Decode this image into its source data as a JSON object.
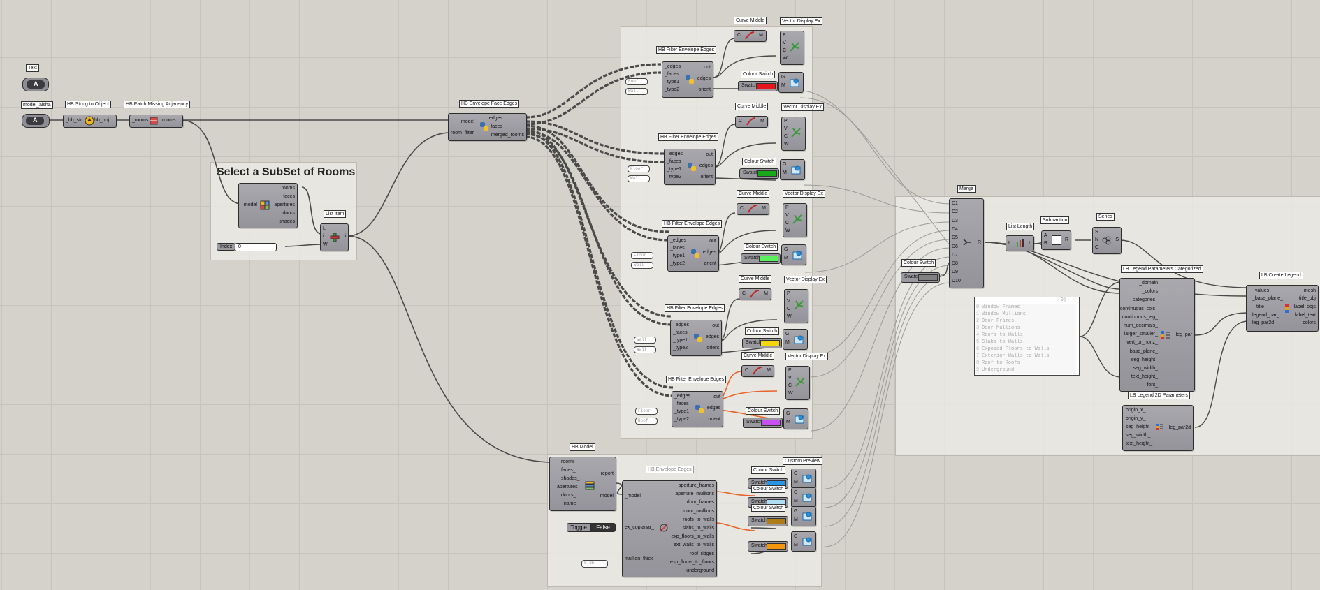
{
  "canvas": {
    "background": "#d5d2cb",
    "grid_color": "#c7c4bd"
  },
  "groups": {
    "select_subset": {
      "title": "Select a SubSet of Rooms"
    }
  },
  "text_param": {
    "tag": "Text",
    "glyph": "A"
  },
  "model_param": {
    "tag": "model_aisha",
    "glyph": "A"
  },
  "string_to_object": {
    "title": "HB String to Object",
    "input": "_hb_str",
    "output": "hb_obj"
  },
  "patch_adjacency": {
    "title": "HB Patch Missing Adjacency",
    "input": "_rooms",
    "output": "rooms"
  },
  "deconstruct": {
    "inputs": [
      "_model"
    ],
    "outputs": [
      "rooms",
      "faces",
      "apertures",
      "doors",
      "shades"
    ]
  },
  "list_item": {
    "title": "List Item",
    "inputs": [
      "L",
      "i",
      "W"
    ],
    "output": "i"
  },
  "index_slider": {
    "label": "Index",
    "value": "0"
  },
  "envelope_face_edges": {
    "title": "HB Envelope Face Edges",
    "inputs": [
      "_model",
      "room_filter_"
    ],
    "outputs": [
      "edges",
      "faces",
      "merged_rooms"
    ]
  },
  "filters": [
    {
      "title": "HB Filter Envelope Edges",
      "inputs": [
        "_edges",
        "_faces",
        "_type1",
        "_type2"
      ],
      "outputs": [
        "out",
        "edges",
        "orient"
      ],
      "panels": [
        "Roof",
        "Wall"
      ],
      "curve_middle": "Curve Middle",
      "vector_display": "Vector Display Ex",
      "colour_switch": "Colour Switch",
      "swatch": "Swatch",
      "color": "#e8141c"
    },
    {
      "title": "HB Filter Envelope Edges",
      "inputs": [
        "_edges",
        "_faces",
        "_type1",
        "_type2"
      ],
      "outputs": [
        "out",
        "edges",
        "orient"
      ],
      "panels": [
        "Floor",
        "Wall"
      ],
      "curve_middle": "Curve Middle",
      "vector_display": "Vector Display Ex",
      "colour_switch": "Colour Switch",
      "swatch": "Swatch",
      "color": "#18a818"
    },
    {
      "title": "HB Filter Envelope Edges",
      "inputs": [
        "_edges",
        "_faces",
        "_type1",
        "_type2"
      ],
      "outputs": [
        "out",
        "edges",
        "orient"
      ],
      "panels": [
        "Floor",
        "Wall"
      ],
      "curve_middle": "Curve Middle",
      "vector_display": "Vector Display Ex",
      "colour_switch": "Colour Switch",
      "swatch": "Swatch",
      "color": "#5cf05c"
    },
    {
      "title": "HB Filter Envelope Edges",
      "inputs": [
        "_edges",
        "_faces",
        "_type1",
        "_type2"
      ],
      "outputs": [
        "out",
        "edges",
        "orient"
      ],
      "panels": [
        "Wall",
        "Wall"
      ],
      "curve_middle": "Curve Middle",
      "vector_display": "Vector Display Ex",
      "colour_switch": "Colour Switch",
      "swatch": "Swatch",
      "color": "#f4d60c"
    },
    {
      "title": "HB Filter Envelope Edges",
      "inputs": [
        "_edges",
        "_faces",
        "_type1",
        "_type2"
      ],
      "outputs": [
        "out",
        "edges",
        "orient"
      ],
      "panels": [
        "Floor",
        "Roof"
      ],
      "curve_middle": "Curve Middle",
      "vector_display": "Vector Display Ex",
      "colour_switch": "Colour Switch",
      "swatch": "Swatch",
      "color": "#c850f0"
    }
  ],
  "curve_middle_pins": {
    "input": "C",
    "output": "M"
  },
  "vector_display_pins": [
    "P",
    "V",
    "C",
    "W"
  ],
  "custom_preview_pins": [
    "G",
    "M"
  ],
  "preview_tag": "Custom Preview",
  "hb_model": {
    "title": "HB Model",
    "inputs": [
      "rooms_",
      "faces_",
      "shades_",
      "apertures_",
      "doors_",
      "_name_"
    ],
    "outputs": [
      "report",
      "model"
    ]
  },
  "hb_envelope_edges": {
    "title": "HB Envelope Edges",
    "inputs": [
      "_model",
      "ex_coplanar_",
      "mullion_thick_"
    ],
    "outputs": [
      "aperture_frames",
      "aperture_mullions",
      "door_frames",
      "door_mullions",
      "roofs_to_walls",
      "slabs_to_walls",
      "exp_floors_to_walls",
      "ext_walls_to_walls",
      "roof_ridges",
      "exp_floors_to_floors",
      "underground"
    ]
  },
  "toggle": {
    "label": "Toggle",
    "value": "False"
  },
  "mullion_panel": "0.25",
  "bottom_swatches": [
    {
      "tag": "Colour Switch",
      "label": "Swatch",
      "color": "#2896e6"
    },
    {
      "tag": "Colour Switch",
      "label": "Swatch",
      "color": "#b0dcf4"
    },
    {
      "tag": "Colour Switch",
      "label": "Swatch",
      "color": "#b07c18"
    },
    {
      "tag": "",
      "label": "Swatch",
      "color": "#f4960c"
    }
  ],
  "merge": {
    "title": "Merge",
    "inputs": [
      "D1",
      "D2",
      "D3",
      "D4",
      "D5",
      "D6",
      "D7",
      "D8",
      "D9",
      "D10"
    ],
    "output": "R"
  },
  "grey_swatch": {
    "tag": "Colour Switch",
    "label": "Swatch",
    "color": "#808080"
  },
  "list_length": {
    "title": "List Length",
    "input": "L",
    "output": "L"
  },
  "subtraction": {
    "title": "Subtraction",
    "inputs": [
      "A",
      "B"
    ],
    "output": "R",
    "symbol": "−"
  },
  "series": {
    "title": "Series",
    "inputs": [
      "S",
      "N",
      "C"
    ],
    "output": "S"
  },
  "legend_list": {
    "header": "{0}",
    "items": [
      "Window Frames",
      "Window Mullions",
      "Door Frames",
      "Door Mullions",
      "Roofs to Walls",
      "Slabs to Walls",
      "Exposed Floors to Walls",
      "Exterior Walls to Walls",
      "Roof to Roofs",
      "Underground"
    ]
  },
  "legend_params": {
    "title": "LB Legend Parameters Categorized",
    "inputs": [
      "_domain",
      "_colors",
      "categories_",
      "continuous_cols_",
      "continuous_leg_",
      "num_decimals_",
      "larger_smaller_",
      "vert_or_horiz_",
      "base_plane_",
      "seg_height_",
      "seg_width_",
      "text_height_",
      "font_"
    ],
    "output": "leg_par"
  },
  "legend_2d": {
    "title": "LB Legend 2D Parameters",
    "inputs": [
      "origin_x_",
      "origin_y_",
      "seg_height_",
      "seg_width_",
      "text_height_"
    ],
    "output": "leg_par2d"
  },
  "create_legend": {
    "title": "LB Create Legend",
    "inputs": [
      "_values",
      "_base_plane_",
      "title_",
      "legend_par_",
      "leg_par2d_"
    ],
    "outputs": [
      "mesh",
      "title_obj",
      "label_objs",
      "label_text",
      "colors"
    ]
  }
}
